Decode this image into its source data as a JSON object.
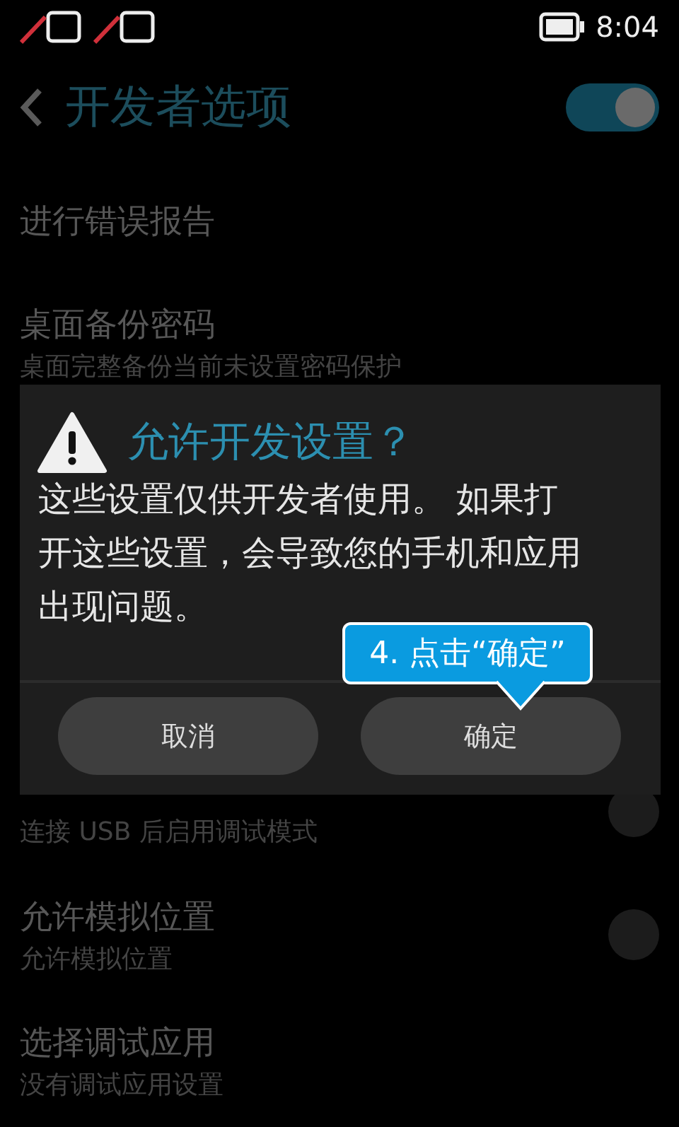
{
  "status_bar": {
    "time": "8:04"
  },
  "app_bar": {
    "title": "开发者选项",
    "master_switch": {
      "on": true
    }
  },
  "settings": [
    {
      "kind": "plain",
      "title": "进行错误报告"
    },
    {
      "kind": "plain",
      "title": "桌面备份密码",
      "subtitle": "桌面完整备份当前未设置密码保护"
    },
    {
      "kind": "switch",
      "subtitle": "连接 USB 后启用调试模式",
      "on": false
    },
    {
      "kind": "switch",
      "title": "允许模拟位置",
      "subtitle": "允许模拟位置",
      "on": false
    },
    {
      "kind": "plain",
      "title": "选择调试应用",
      "subtitle": "没有调试应用设置"
    }
  ],
  "dialog": {
    "title": "允许开发设置？",
    "message": "这些设置仅供开发者使用。 如果打开这些设置，会导致您的手机和应用出现问题。",
    "buttons": [
      "取消",
      "确定"
    ]
  },
  "callout": {
    "text": "4. 点击“确定”"
  }
}
